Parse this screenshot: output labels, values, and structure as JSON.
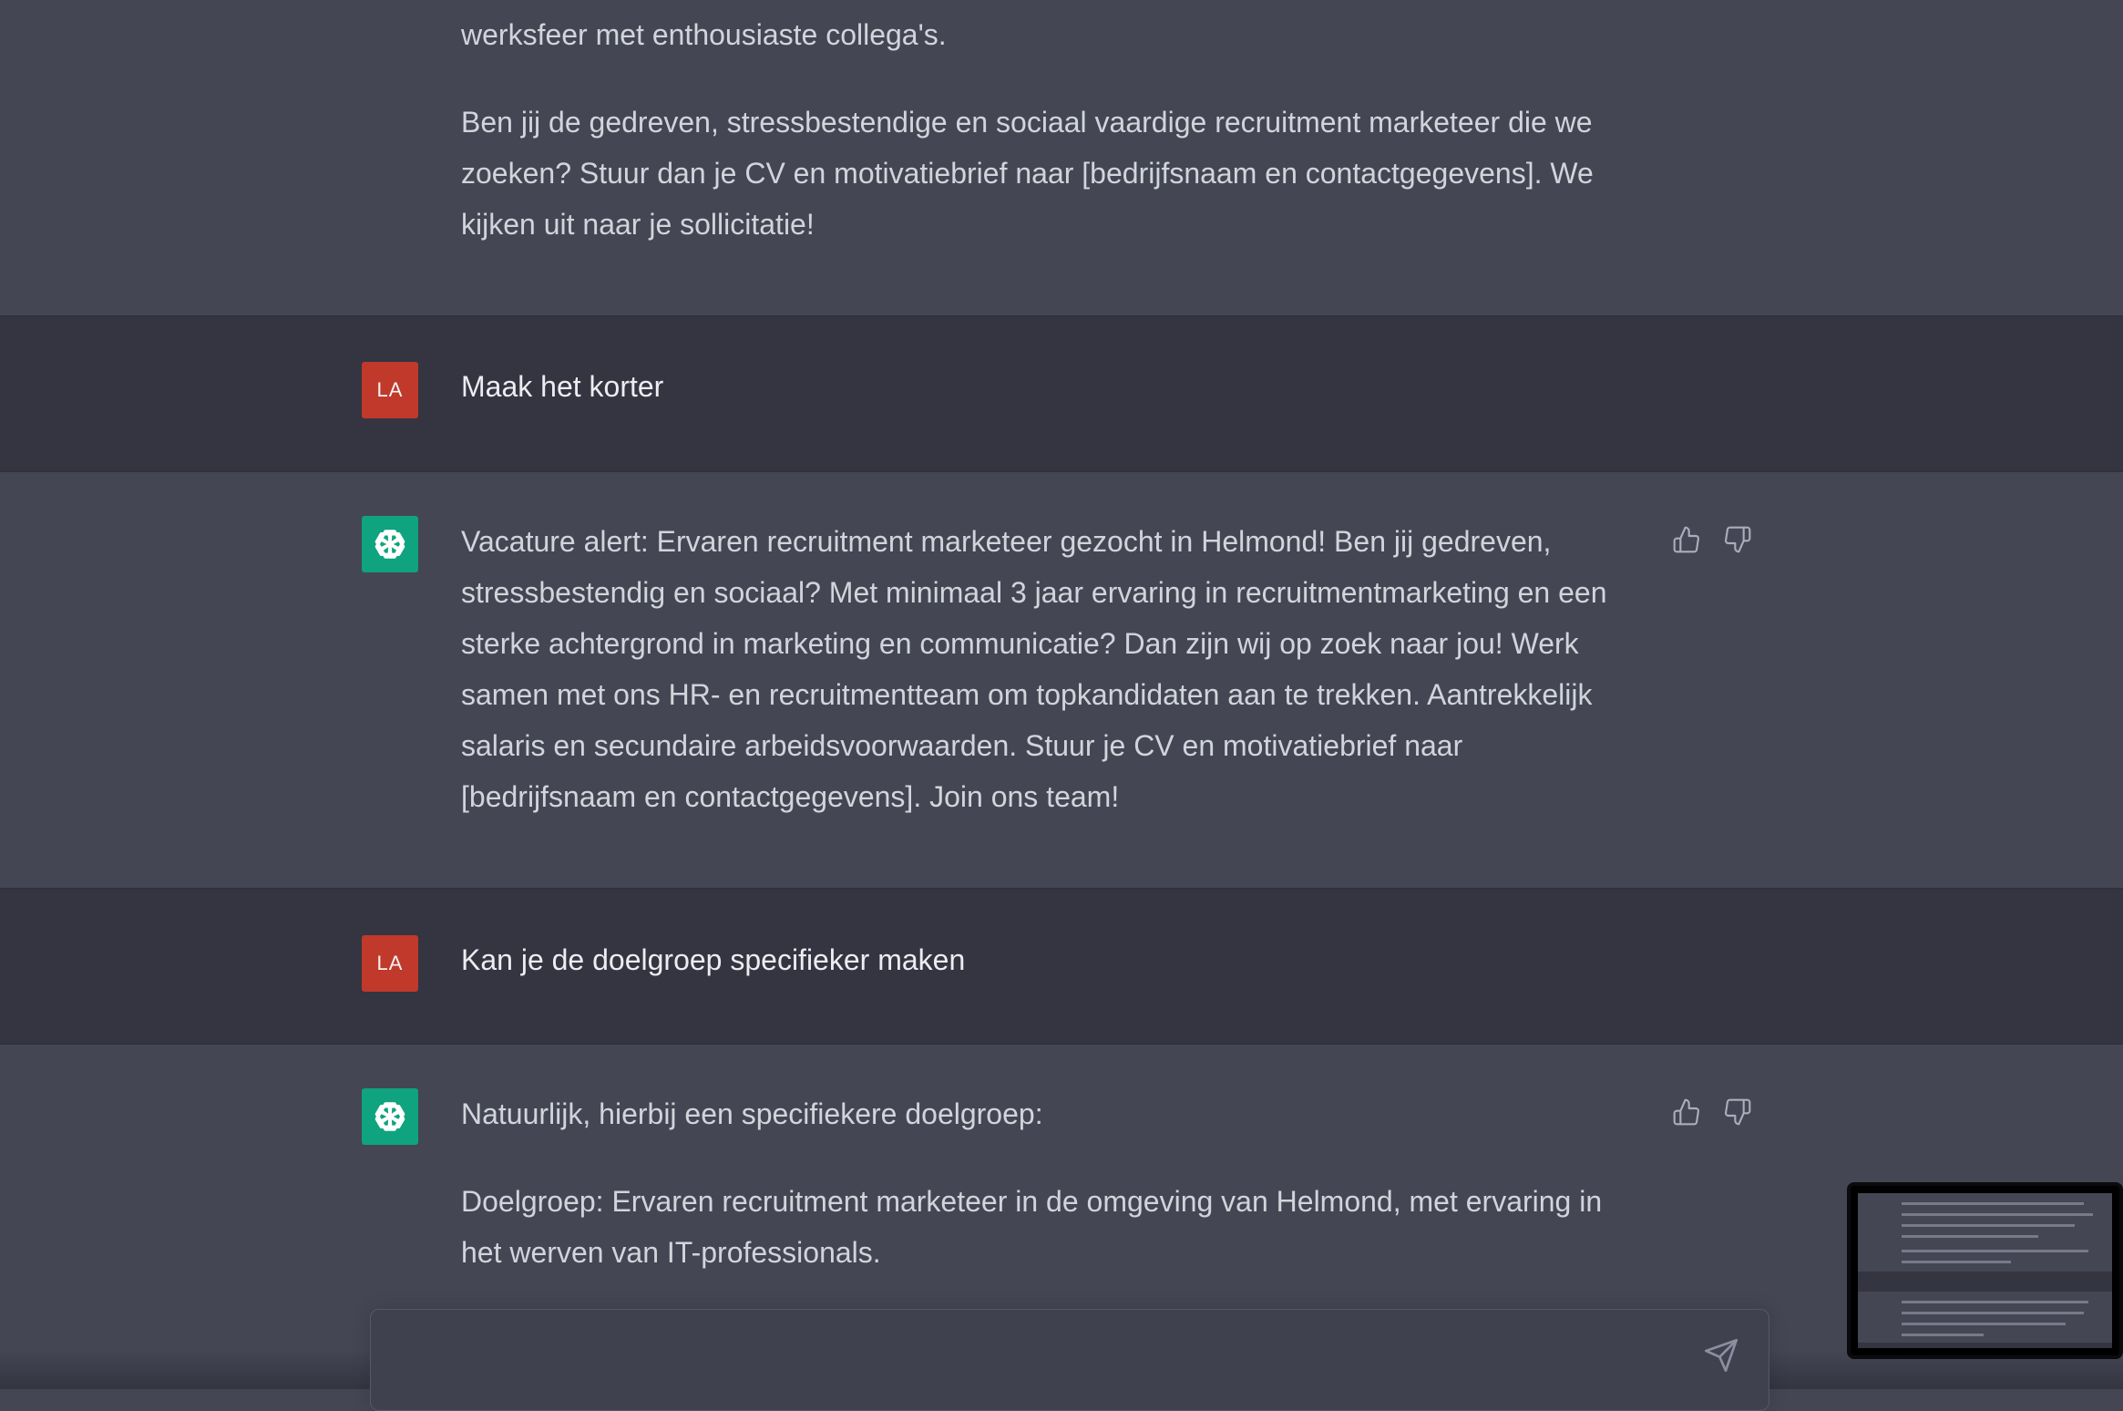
{
  "conversation": {
    "prev_tail": "werksfeer met enthousiaste collega's.",
    "prev_cta": "Ben jij de gedreven, stressbestendige en sociaal vaardige recruitment marketeer die we zoeken? Stuur dan je CV en motivatiebrief naar [bedrijfsnaam en contactgegevens]. We kijken uit naar je sollicitatie!",
    "user_avatar": "LA",
    "user_1": "Maak het korter",
    "assistant_1": "Vacature alert: Ervaren recruitment marketeer gezocht in Helmond! Ben jij gedreven, stressbestendig en sociaal? Met minimaal 3 jaar ervaring in recruitmentmarketing en een sterke achtergrond in marketing en communicatie? Dan zijn wij op zoek naar jou! Werk samen met ons HR- en recruitmentteam om topkandidaten aan te trekken. Aantrekkelijk salaris en secundaire arbeidsvoorwaarden. Stuur je CV en motivatiebrief naar [bedrijfsnaam en contactgegevens]. Join ons team!",
    "user_2": "Kan je de doelgroep specifieker maken",
    "assistant_2_intro": "Natuurlijk, hierbij een specifiekere doelgroep:",
    "assistant_2_body": "Doelgroep: Ervaren recruitment marketeer in de omgeving van Helmond, met ervaring in het werven van IT-professionals."
  },
  "composer": {
    "placeholder": "",
    "value": ""
  },
  "icons": {
    "thumbs_up": "thumbs-up-icon",
    "thumbs_down": "thumbs-down-icon",
    "send": "paper-plane-icon",
    "assistant_logo": "openai-logo-icon"
  },
  "colors": {
    "assistant_bg": "#444654",
    "user_bg": "#343541",
    "user_avatar": "#c0392b",
    "bot_avatar": "#10a37f"
  }
}
